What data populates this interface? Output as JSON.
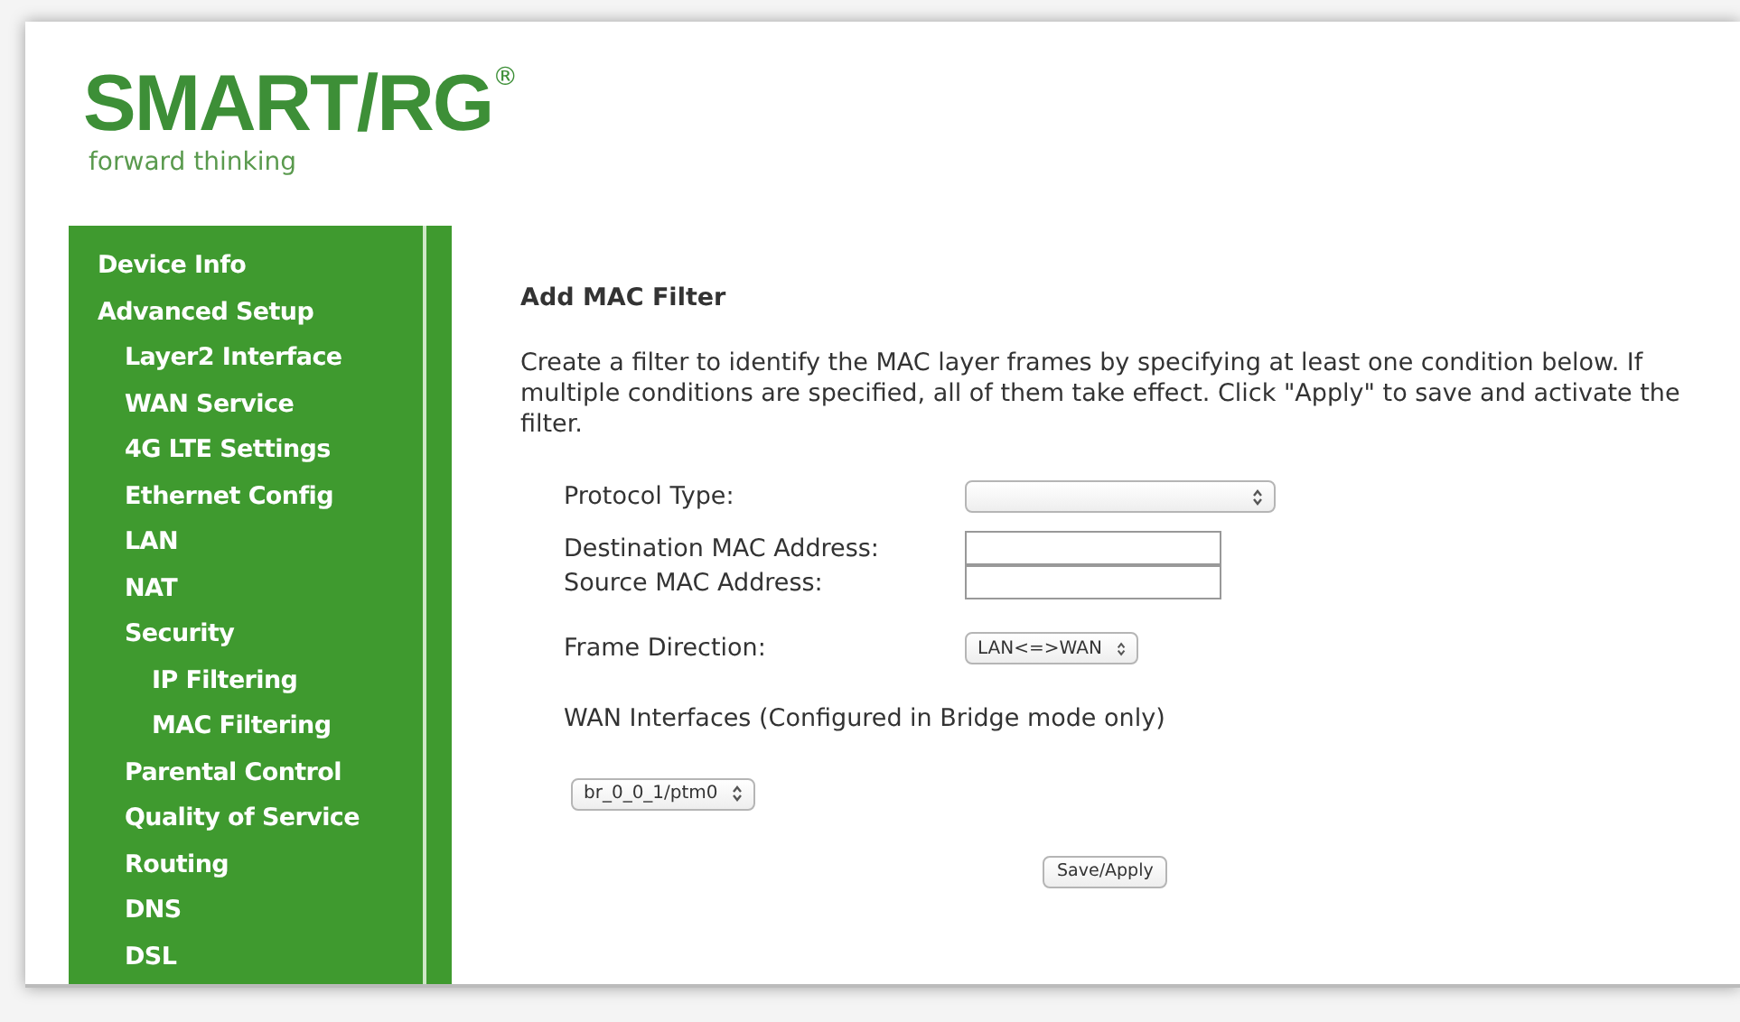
{
  "logo": {
    "brand": "SMART/RG",
    "mark": "®",
    "tagline": "forward thinking"
  },
  "sidebar": {
    "items": [
      {
        "label": "Device Info"
      },
      {
        "label": "Advanced Setup",
        "children": [
          {
            "label": "Layer2 Interface"
          },
          {
            "label": "WAN Service"
          },
          {
            "label": "4G LTE Settings"
          },
          {
            "label": "Ethernet Config"
          },
          {
            "label": "LAN"
          },
          {
            "label": "NAT"
          },
          {
            "label": "Security",
            "children": [
              {
                "label": "IP Filtering"
              },
              {
                "label": "MAC Filtering"
              }
            ]
          },
          {
            "label": "Parental Control"
          },
          {
            "label": "Quality of Service"
          },
          {
            "label": "Routing"
          },
          {
            "label": "DNS"
          },
          {
            "label": "DSL"
          }
        ]
      }
    ]
  },
  "form": {
    "title": "Add MAC Filter",
    "description": "Create a filter to identify the MAC layer frames by specifying at least one condition below. If multiple conditions are specified, all of them take effect. Click \"Apply\" to save and activate the filter.",
    "fields": [
      {
        "kind": "select",
        "label": "Protocol Type:"
      },
      {
        "kind": "text",
        "label": "Destination MAC Address:"
      },
      {
        "kind": "text",
        "label": "Source MAC Address:"
      },
      {
        "kind": "select",
        "label": "Frame Direction:",
        "value": "LAN<=>WAN"
      }
    ],
    "wan_label": "WAN Interfaces (Configured in Bridge mode only)",
    "wan_select": {
      "value": "br_0_0_1/ptm0"
    },
    "button": "Save/Apply"
  }
}
